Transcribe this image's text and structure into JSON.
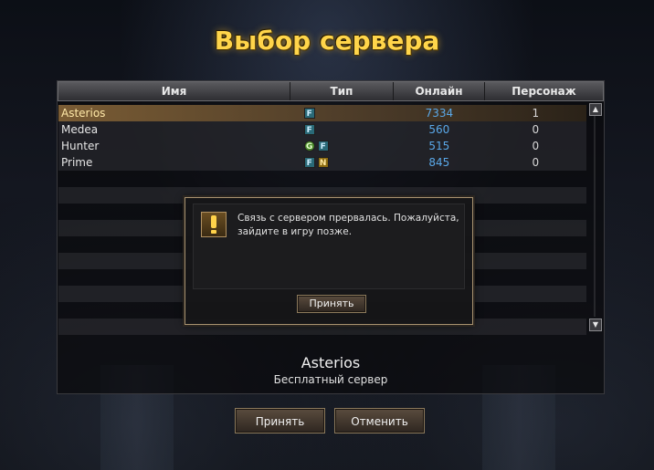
{
  "title": "Выбор сервера",
  "columns": {
    "name": "Имя",
    "type": "Тип",
    "online": "Онлайн",
    "characters": "Персонаж"
  },
  "servers": [
    {
      "name": "Asterios",
      "badges": [
        "F"
      ],
      "online": "7334",
      "characters": "1",
      "selected": true
    },
    {
      "name": "Medea",
      "badges": [
        "F"
      ],
      "online": "560",
      "characters": "0",
      "selected": false
    },
    {
      "name": "Hunter",
      "badges": [
        "G",
        "F"
      ],
      "online": "515",
      "characters": "0",
      "selected": false
    },
    {
      "name": "Prime",
      "badges": [
        "F",
        "N"
      ],
      "online": "845",
      "characters": "0",
      "selected": false
    }
  ],
  "selected_server": {
    "name": "Asterios",
    "description": "Бесплатный сервер"
  },
  "dialog": {
    "message": "Связь с сервером прервалась. Пожалуйста, зайдите в игру позже.",
    "icon": "warning-icon",
    "ok_label": "Принять"
  },
  "buttons": {
    "accept_label": "Принять",
    "cancel_label": "Отменить"
  },
  "colors": {
    "title": "#ffd54a",
    "online": "#5aa8e8",
    "selected_row": "#7a5c34"
  }
}
